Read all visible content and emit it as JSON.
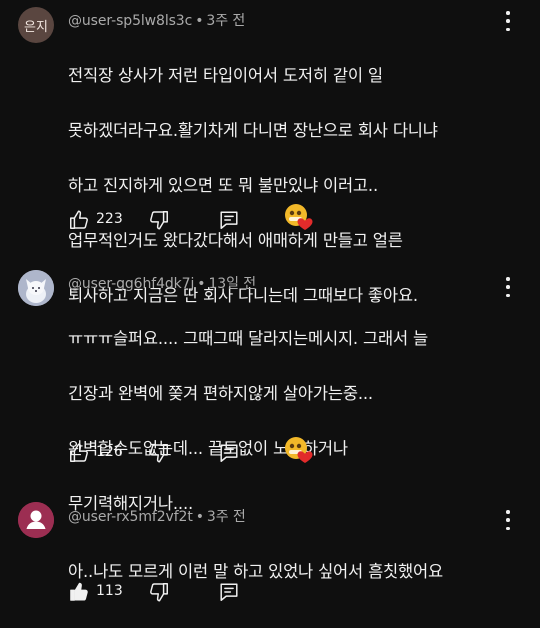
{
  "comments": [
    {
      "avatar_text": "은지",
      "author": "@user-sp5lw8ls3c",
      "separator": "•",
      "time": "3주 전",
      "lines": [
        "전직장 상사가 저런 타입이어서 도저히 같이 일",
        "못하겠더라구요.활기차게 다니면 장난으로 회사 다니냐",
        "하고 진지하게 있으면 또 뭐 불만있냐 이러고..",
        "업무적인거도 왔다갔다해서 애매하게 만들고 얼른",
        "퇴사하고 지금은 딴 회사 다니는데 그때보다 좋아요."
      ],
      "likes": "223",
      "liked": false,
      "creator_heart": true
    },
    {
      "avatar_icon": "fox-avatar-icon",
      "author": "@user-gg6hf4dk7j",
      "separator": "•",
      "time": "13일 전",
      "lines": [
        "ㅠㅠㅠ슬퍼요.... 그때그때 달라지는메시지. 그래서 늘",
        "긴장과 완벽에 쫒겨 편하지않게 살아가는중...",
        "완벽할수도없는데... 끝도없이 노력하거나",
        "무기력해지거나...."
      ],
      "likes": "126",
      "liked": false,
      "creator_heart": true
    },
    {
      "avatar_icon": "default-user-avatar-icon",
      "author": "@user-rx5mf2vf2t",
      "separator": "•",
      "time": "3주 전",
      "lines": [
        "아..나도 모르게 이런 말 하고 있었나 싶어서 흠칫했어요"
      ],
      "likes": "113",
      "liked": true,
      "creator_heart": false
    }
  ],
  "colors": {
    "background": "#0f0f0f",
    "text_primary": "#f1f1f1",
    "text_secondary": "#aaaaaa",
    "heart": "#e22b2b"
  }
}
